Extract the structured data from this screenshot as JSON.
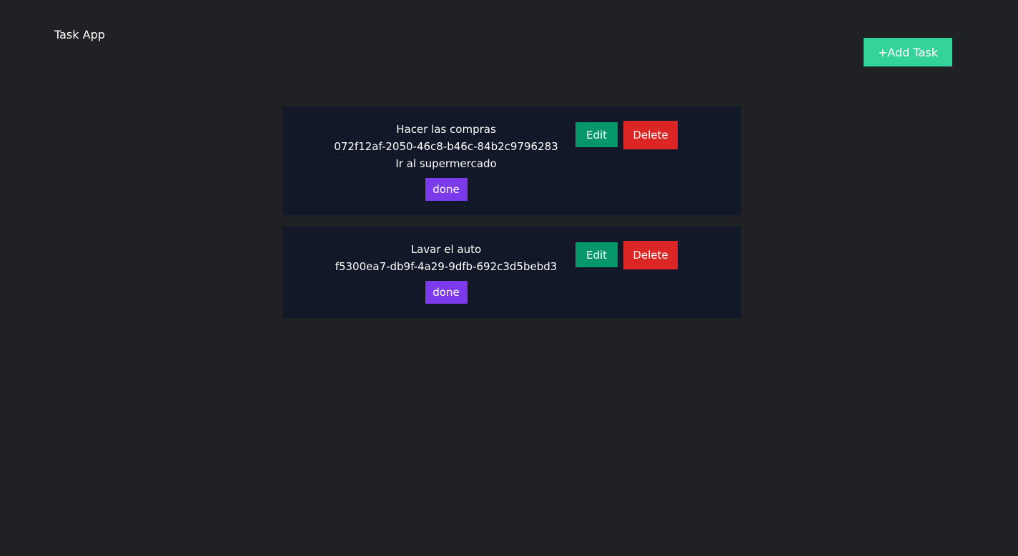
{
  "header": {
    "title": "Task App",
    "add_task_label": "+Add Task",
    "add_task_color": "#34d399"
  },
  "colors": {
    "background": "#202124",
    "card": "#111827",
    "edit": "#059669",
    "delete": "#dc2626",
    "done": "#7c3aed"
  },
  "tasks": [
    {
      "title": "Hacer las compras",
      "id": "072f12af-2050-46c8-b46c-84b2c9796283",
      "description": "Ir al supermercado",
      "done_label": "done",
      "edit_label": "Edit",
      "delete_label": "Delete"
    },
    {
      "title": "Lavar el auto",
      "id": "f5300ea7-db9f-4a29-9dfb-692c3d5bebd3",
      "done_label": "done",
      "edit_label": "Edit",
      "delete_label": "Delete"
    }
  ]
}
